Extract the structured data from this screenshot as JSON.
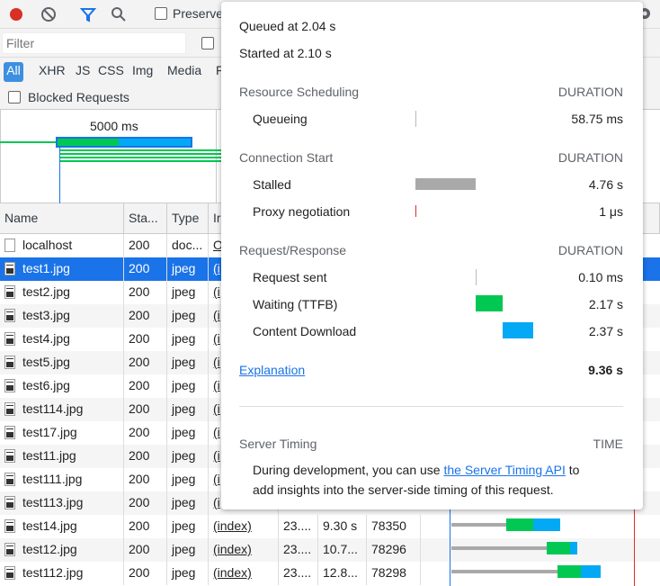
{
  "toolbar": {
    "preserve_label": "Preserve",
    "icons": [
      "record-icon",
      "clear-icon",
      "filter-icon",
      "search-icon",
      "gear-icon"
    ]
  },
  "filter": {
    "placeholder": "Filter"
  },
  "types": [
    "All",
    "XHR",
    "JS",
    "CSS",
    "Img",
    "Media",
    "F"
  ],
  "blocked_label": "Blocked Requests",
  "overview": {
    "tick_label": "5000 ms"
  },
  "table": {
    "headers": [
      "Name",
      "Sta...",
      "Type",
      "Ir"
    ],
    "rows": [
      {
        "name": "localhost",
        "status": "200",
        "type": "doc...",
        "init": "O",
        "icon": "doc"
      },
      {
        "name": "test1.jpg",
        "status": "200",
        "type": "jpeg",
        "init": "(i",
        "icon": "img"
      },
      {
        "name": "test2.jpg",
        "status": "200",
        "type": "jpeg",
        "init": "(i",
        "icon": "img"
      },
      {
        "name": "test3.jpg",
        "status": "200",
        "type": "jpeg",
        "init": "(i",
        "icon": "img"
      },
      {
        "name": "test4.jpg",
        "status": "200",
        "type": "jpeg",
        "init": "(i",
        "icon": "img"
      },
      {
        "name": "test5.jpg",
        "status": "200",
        "type": "jpeg",
        "init": "(i",
        "icon": "img"
      },
      {
        "name": "test6.jpg",
        "status": "200",
        "type": "jpeg",
        "init": "(i",
        "icon": "img"
      },
      {
        "name": "test114.jpg",
        "status": "200",
        "type": "jpeg",
        "init": "(i",
        "icon": "img"
      },
      {
        "name": "test17.jpg",
        "status": "200",
        "type": "jpeg",
        "init": "(i",
        "icon": "img"
      },
      {
        "name": "test11.jpg",
        "status": "200",
        "type": "jpeg",
        "init": "(i",
        "icon": "img"
      },
      {
        "name": "test111.jpg",
        "status": "200",
        "type": "jpeg",
        "init": "(i",
        "icon": "img"
      },
      {
        "name": "test113.jpg",
        "status": "200",
        "type": "jpeg",
        "init": "(i",
        "icon": "img"
      },
      {
        "name": "test14.jpg",
        "status": "200",
        "type": "jpeg",
        "init": "(index)",
        "size": "23....",
        "time": "9.30 s",
        "bytes": "78350",
        "icon": "img"
      },
      {
        "name": "test12.jpg",
        "status": "200",
        "type": "jpeg",
        "init": "(index)",
        "size": "23....",
        "time": "10.7...",
        "bytes": "78296",
        "icon": "img"
      },
      {
        "name": "test112.jpg",
        "status": "200",
        "type": "jpeg",
        "init": "(index)",
        "size": "23....",
        "time": "12.8...",
        "bytes": "78298",
        "icon": "img"
      }
    ]
  },
  "popover": {
    "queued": "Queued at 2.04 s",
    "started": "Started at 2.10 s",
    "resource_scheduling": "Resource Scheduling",
    "connection_start": "Connection Start",
    "request_response": "Request/Response",
    "duration_label": "DURATION",
    "queueing_label": "Queueing",
    "queueing_value": "58.75 ms",
    "stalled_label": "Stalled",
    "stalled_value": "4.76 s",
    "proxy_label": "Proxy negotiation",
    "proxy_value": "1 μs",
    "sent_label": "Request sent",
    "sent_value": "0.10 ms",
    "waiting_label": "Waiting (TTFB)",
    "waiting_value": "2.17 s",
    "download_label": "Content Download",
    "download_value": "2.37 s",
    "explanation": "Explanation",
    "total": "9.36 s",
    "server_timing": "Server Timing",
    "time_label": "TIME",
    "desc_prefix": "During development, you can use ",
    "desc_link": "the Server Timing API",
    "desc_suffix": " to",
    "desc_line2": "add insights into the server-side timing of this request."
  },
  "colors": {
    "accent": "#1a73e8",
    "waiting": "#00c853",
    "download": "#03a9f4",
    "stalled": "#a9a9a9",
    "record": "#d93025"
  }
}
